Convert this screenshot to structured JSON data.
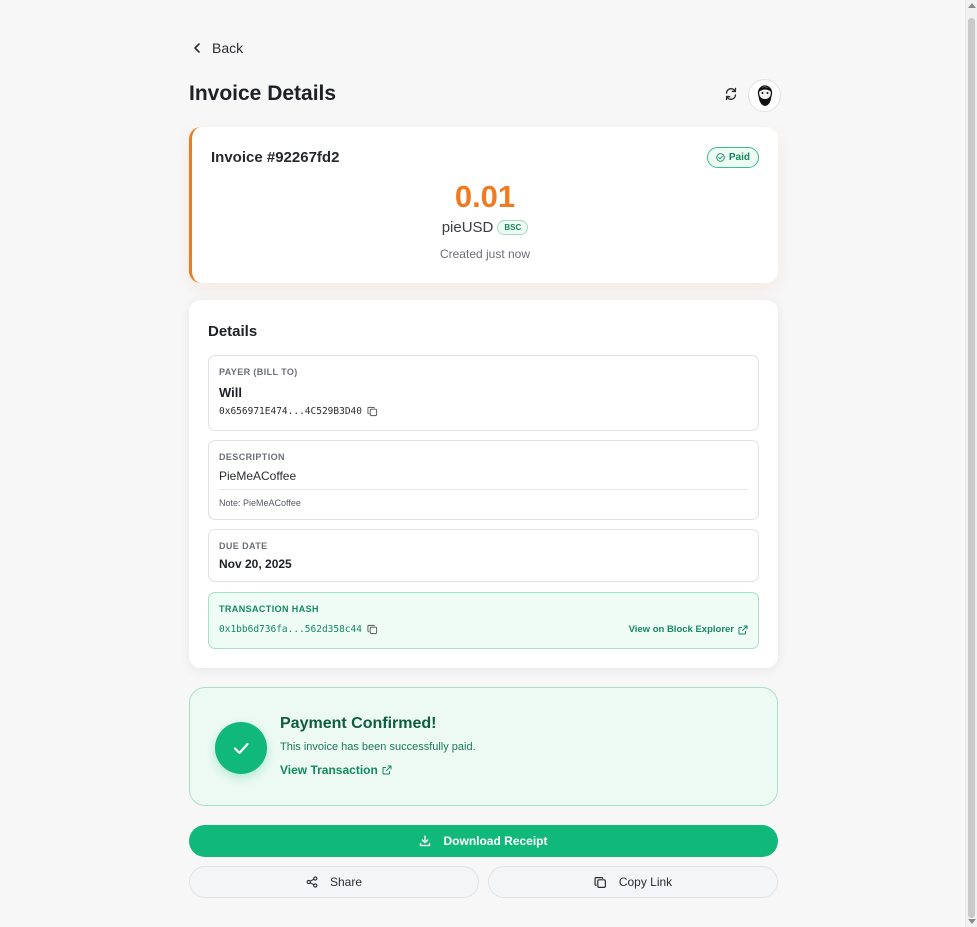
{
  "nav": {
    "back_label": "Back"
  },
  "header": {
    "title": "Invoice Details",
    "refresh_icon": "refresh-icon",
    "avatar_icon": "bearded-avatar"
  },
  "invoice": {
    "number": "Invoice #92267fd2",
    "status": "Paid",
    "amount": "0.01",
    "currency": "pieUSD",
    "chain": "BSC",
    "created": "Created just now",
    "accent_color": "#f07a1f"
  },
  "details": {
    "title": "Details",
    "payer": {
      "label": "PAYER (BILL TO)",
      "name": "Will",
      "address": "0x656971E474...4C529B3D40"
    },
    "description": {
      "label": "DESCRIPTION",
      "value": "PieMeACoffee",
      "note_prefix": "Note:",
      "note": "PieMeACoffee"
    },
    "due_date": {
      "label": "DUE DATE",
      "value": "Nov 20, 2025"
    },
    "transaction": {
      "label": "TRANSACTION HASH",
      "hash": "0x1bb6d736fa...562d358c44",
      "explorer_label": "View on Block Explorer"
    }
  },
  "confirmation": {
    "title": "Payment Confirmed!",
    "subtitle": "This invoice has been successfully paid.",
    "link_label": "View Transaction",
    "success_color": "#10b97a"
  },
  "actions": {
    "download_label": "Download Receipt",
    "share_label": "Share",
    "copy_link_label": "Copy Link"
  }
}
